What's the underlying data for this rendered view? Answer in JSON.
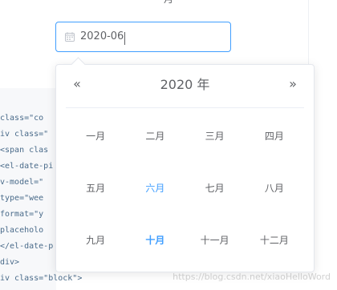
{
  "top": {
    "partial_label": "月"
  },
  "date_picker": {
    "input_value": "2020-06",
    "popover": {
      "year_label": "2020 年",
      "prev_year_glyph": "«",
      "next_year_glyph": "»",
      "months": [
        {
          "label": "一月"
        },
        {
          "label": "二月"
        },
        {
          "label": "三月"
        },
        {
          "label": "四月"
        },
        {
          "label": "五月"
        },
        {
          "label": "六月",
          "state": "selected"
        },
        {
          "label": "七月"
        },
        {
          "label": "八月"
        },
        {
          "label": "九月"
        },
        {
          "label": "十月",
          "state": "current"
        },
        {
          "label": "十一月"
        },
        {
          "label": "十二月"
        }
      ]
    }
  },
  "background_code": {
    "lines": [
      "  class=\"co",
      "iv class=\"",
      "<span clas",
      "<el-date-pi",
      "  v-model=\"",
      "  type=\"wee",
      "  format=\"y",
      "  placeholo",
      "</el-date-p",
      "div>",
      "iv class=\"block\">"
    ]
  },
  "watermark": {
    "text": "https://blog.csdn.net/xiaoHelloWord"
  },
  "colors": {
    "accent": "#409eff",
    "text": "#606266",
    "border": "#e4e7ed"
  },
  "icons": {
    "calendar": "calendar-icon",
    "prev_year": "double-chevron-left-icon",
    "next_year": "double-chevron-right-icon"
  }
}
